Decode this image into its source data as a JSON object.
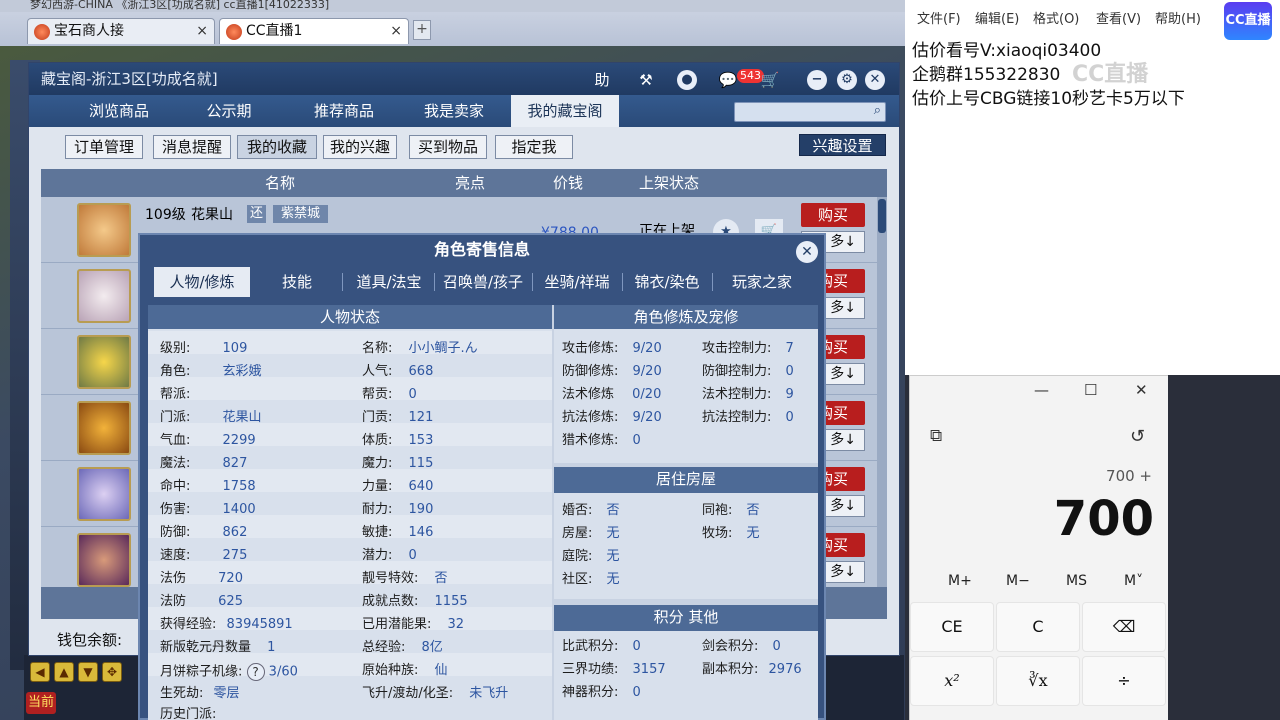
{
  "browser": {
    "top_text": "梦幻西游-CHINA    《浙江3区[功成名就]    cc直播1[41022333]",
    "tabs": [
      {
        "label": "宝石商人接",
        "close": "×"
      },
      {
        "label": "CC直播1",
        "close": "×"
      }
    ],
    "new_tab": "+"
  },
  "cbg": {
    "title": "藏宝阁-浙江3区[功成名就]",
    "help_label": "助",
    "message_badge": "543",
    "nav_tabs": [
      "浏览商品",
      "公示期",
      "推荐商品",
      "我是卖家",
      "我的藏宝阁"
    ],
    "sub_buttons": [
      "订单管理",
      "消息提醒",
      "我的收藏",
      "我的兴趣",
      "买到物品",
      "指定我"
    ],
    "interest_settings": "兴趣设置",
    "columns": [
      "名称",
      "亮点",
      "价钱",
      "上架状态"
    ],
    "first_row": {
      "level": "109级",
      "school": "花果山",
      "tag1": "还",
      "server": "紫禁城",
      "price": "¥788.00",
      "status": "正在上架"
    },
    "buy_label": "购买",
    "more_label": "多↓",
    "wallet_label": "钱包余额:"
  },
  "role": {
    "title": "角色寄售信息",
    "tabs": [
      "人物/修炼",
      "技能",
      "道具/法宝",
      "召唤兽/孩子",
      "坐骑/祥瑞",
      "锦衣/染色",
      "玩家之家"
    ],
    "status_title": "人物状态",
    "status_left": [
      {
        "k": "级别:",
        "v": "109"
      },
      {
        "k": "角色:",
        "v": "玄彩娥"
      },
      {
        "k": "帮派:",
        "v": ""
      },
      {
        "k": "门派:",
        "v": "花果山"
      },
      {
        "k": "气血:",
        "v": "2299"
      },
      {
        "k": "魔法:",
        "v": "827"
      },
      {
        "k": "命中:",
        "v": "1758"
      },
      {
        "k": "伤害:",
        "v": "1400"
      },
      {
        "k": "防御:",
        "v": "862"
      },
      {
        "k": "速度:",
        "v": "275"
      },
      {
        "k": "法伤",
        "v": "720"
      },
      {
        "k": "法防",
        "v": "625"
      },
      {
        "k": "获得经验:",
        "v": "83945891"
      },
      {
        "k": "新版乾元丹数量",
        "v": "1"
      },
      {
        "k": "月饼粽子机缘:",
        "v": "3/60"
      },
      {
        "k": "生死劫:",
        "v": "零层"
      },
      {
        "k": "历史门派:",
        "v": ""
      }
    ],
    "status_right": [
      {
        "k": "名称:",
        "v": "小小鲷子.ん"
      },
      {
        "k": "人气:",
        "v": "668"
      },
      {
        "k": "帮贡:",
        "v": "0"
      },
      {
        "k": "门贡:",
        "v": "121"
      },
      {
        "k": "体质:",
        "v": "153"
      },
      {
        "k": "魔力:",
        "v": "115"
      },
      {
        "k": "力量:",
        "v": "640"
      },
      {
        "k": "耐力:",
        "v": "190"
      },
      {
        "k": "敏捷:",
        "v": "146"
      },
      {
        "k": "潜力:",
        "v": "0"
      },
      {
        "k": "靓号特效:",
        "v": "否"
      },
      {
        "k": "成就点数:",
        "v": "1155"
      },
      {
        "k": "已用潜能果:",
        "v": "32"
      },
      {
        "k": "总经验:",
        "v": "8亿"
      },
      {
        "k": "原始种族:",
        "v": "仙"
      },
      {
        "k": "飞升/渡劫/化圣:",
        "v": "未飞升"
      }
    ],
    "cult_title": "角色修炼及宠修",
    "cult_left": [
      {
        "k": "攻击修炼:",
        "v": "9/20"
      },
      {
        "k": "防御修炼:",
        "v": "9/20"
      },
      {
        "k": "法术修炼",
        "v": "0/20"
      },
      {
        "k": "抗法修炼:",
        "v": "9/20"
      },
      {
        "k": "猎术修炼:",
        "v": "0"
      }
    ],
    "cult_right": [
      {
        "k": "攻击控制力:",
        "v": "7"
      },
      {
        "k": "防御控制力:",
        "v": "0"
      },
      {
        "k": "法术控制力:",
        "v": "9"
      },
      {
        "k": "抗法控制力:",
        "v": "0"
      }
    ],
    "house_title": "居住房屋",
    "house_left": [
      {
        "k": "婚否:",
        "v": "否"
      },
      {
        "k": "房屋:",
        "v": "无"
      },
      {
        "k": "庭院:",
        "v": "无"
      },
      {
        "k": "社区:",
        "v": "无"
      }
    ],
    "house_right": [
      {
        "k": "同袍:",
        "v": "否"
      },
      {
        "k": "牧场:",
        "v": "无"
      }
    ],
    "score_title": "积分 其他",
    "score_left": [
      {
        "k": "比武积分:",
        "v": "0"
      },
      {
        "k": "三界功绩:",
        "v": "3157"
      },
      {
        "k": "神器积分:",
        "v": "0"
      }
    ],
    "score_right": [
      {
        "k": "剑会积分:",
        "v": "0"
      },
      {
        "k": "副本积分:",
        "v": "2976"
      }
    ]
  },
  "bottom": {
    "current_label": "当前"
  },
  "notepad": {
    "menu": [
      "文件(F)",
      "编辑(E)",
      "格式(O)",
      "查看(V)",
      "帮助(H)"
    ],
    "lines": [
      "估价看号V:xiaoqi03400",
      "企鹅群155322830",
      "估价上号CBG链接10秒艺卡5万以下"
    ],
    "logo": "CC直播",
    "watermark": "CC直播"
  },
  "calculator": {
    "expression": "700 +",
    "result": "700",
    "memory": [
      "M+",
      "M−",
      "MS",
      "M˅"
    ],
    "keys_row1": [
      "CE",
      "C",
      "⌫"
    ],
    "keys_row2": [
      "x²",
      "∛x",
      "÷"
    ],
    "window_controls": [
      "—",
      "☐",
      "✕"
    ]
  }
}
